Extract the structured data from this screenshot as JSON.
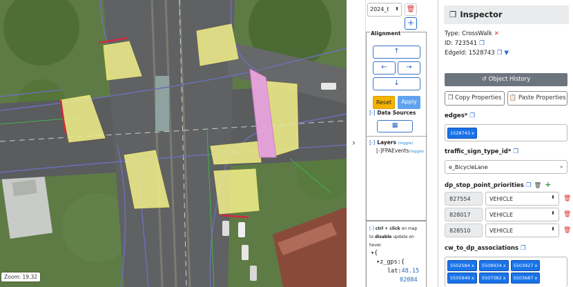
{
  "map": {
    "zoom_label": "Zoom: 19.32"
  },
  "controls": {
    "date_value": "2024_t",
    "alignment_title": "Alignment",
    "arrows": {
      "up": "↑",
      "left": "←",
      "right": "→",
      "down": "↓"
    },
    "reset_label": "Reset",
    "apply_label": "Apply",
    "data_sources_label": "Data Sources",
    "layers_label": "Layers",
    "toggle_label": "(toggle)",
    "layer_items": [
      {
        "label": "FPAEvents"
      }
    ],
    "collapse_marker": "[-]",
    "hint": {
      "marker": "[-]",
      "keys": "ctrl + click",
      "text1": " on map",
      "text2": "to ",
      "bold": "disable",
      "text3": " update on",
      "text4": "hover"
    },
    "json_tree": {
      "open": "{",
      "key": "z_gps:",
      "inner_open": "{",
      "lat_key": "lat:",
      "lat_value_1": "48.15",
      "lat_value_2": "02084"
    }
  },
  "inspector": {
    "title": "Inspector",
    "type_text": "Type: CrossWalk",
    "id_text": "ID: 723541",
    "edge_id_text": "EdgeId: 1528743",
    "object_history_label": "Object History",
    "copy_properties_label": "Copy Properties",
    "paste_properties_label": "Paste Properties",
    "edges_label": "edges*",
    "edges_chips": [
      "1528743 x"
    ],
    "traffic_sign_label": "traffic_sign_type_id*",
    "traffic_sign_value": "e_BicycleLane",
    "dp_stop_label": "dp_stop_point_priorities",
    "dp_stop_rows": [
      {
        "id": "827554",
        "value": "VEHICLE"
      },
      {
        "id": "828017",
        "value": "VEHICLE"
      },
      {
        "id": "828510",
        "value": "VEHICLE"
      }
    ],
    "cw_label": "cw_to_dp_associations",
    "cw_chips": [
      "5502584 x",
      "5508934 x",
      "5503927 x",
      "5505949 x",
      "5507382 x",
      "5503687 x"
    ]
  },
  "colors": {
    "accent": "#1a73e8",
    "crosswalk": "#f2f08a",
    "selected_crosswalk": "#f0a8e4",
    "edge_line": "#6d6fb5",
    "reset": "#f5b301",
    "apply": "#5fa3ee",
    "danger": "#e03131"
  }
}
